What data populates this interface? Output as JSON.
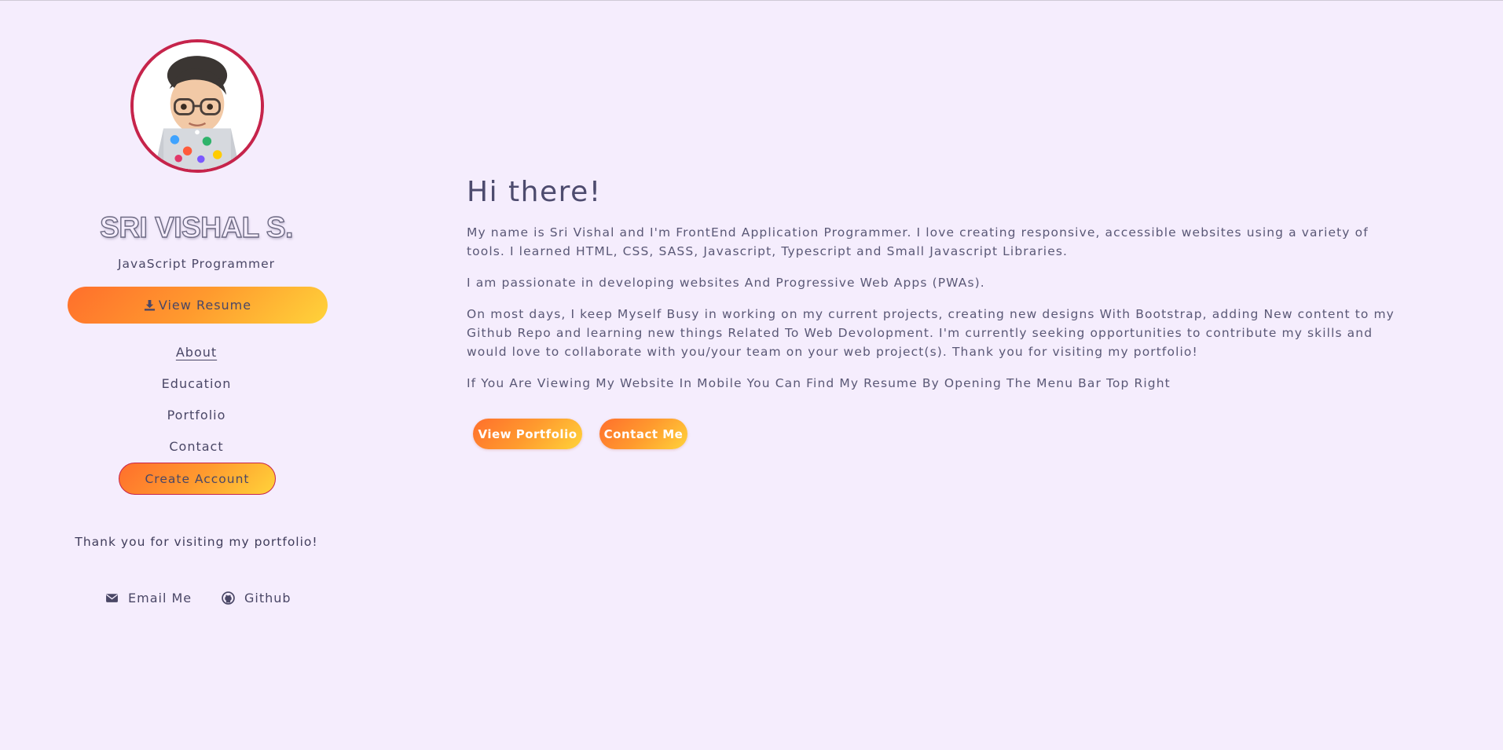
{
  "profile": {
    "name": "SRI VISHAL S.",
    "role": "JavaScript Programmer",
    "resume_label": "View Resume"
  },
  "nav": {
    "about": "About",
    "education": "Education",
    "portfolio": "Portfolio",
    "contact": "Contact",
    "create_account": "Create Account"
  },
  "footer": {
    "thanks": "Thank you for visiting my portfolio!",
    "email_label": "Email Me",
    "github_label": "Github"
  },
  "main": {
    "greeting": "Hi there!",
    "paragraphs": [
      "My name is Sri Vishal and I'm FrontEnd Application Programmer. I love creating responsive, accessible websites using a variety of tools. I learned HTML, CSS, SASS, Javascript, Typescript and Small Javascript Libraries.",
      "I am passionate in developing websites And Progressive Web Apps (PWAs).",
      "On most days, I keep Myself Busy in working on my current projects, creating new designs With Bootstrap, adding New content to my Github Repo and learning new things Related To Web Devolopment. I'm currently seeking opportunities to contribute my skills and would love to collaborate with you/your team on your web project(s). Thank you for visiting my portfolio!",
      "If You Are Viewing My Website In Mobile You Can Find My Resume By Opening The Menu Bar Top Right"
    ],
    "view_portfolio_label": "View Portfolio",
    "contact_me_label": "Contact Me"
  },
  "colors": {
    "background": "#f5edfd",
    "text": "#4d4b6e",
    "accent_border": "#c6244b",
    "gradient_start": "#ff6f2c",
    "gradient_end": "#ffd33a"
  },
  "icons": {
    "resume": "download-icon",
    "email": "envelope-icon",
    "github": "github-icon",
    "avatar": "memoji-developer-avatar"
  }
}
